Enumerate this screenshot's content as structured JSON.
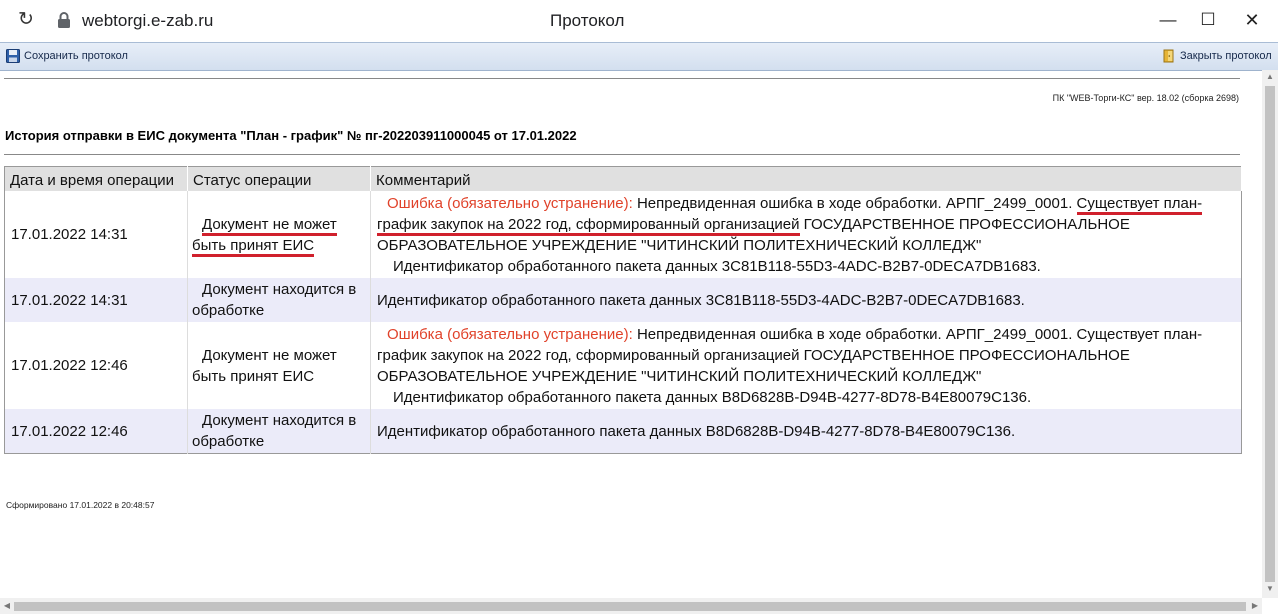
{
  "browser": {
    "url": "webtorgi.e-zab.ru",
    "window_title": "Протокол",
    "reload_glyph": "↻",
    "minimize_glyph": "—",
    "maximize_glyph": "☐",
    "close_glyph": "✕"
  },
  "toolbar": {
    "save_label": "Сохранить протокол",
    "close_label": "Закрыть протокол"
  },
  "report": {
    "version": "ПК \"WEB-Торги-КС\" вер. 18.02 (сборка 2698)",
    "heading": "История отправки в ЕИС документа \"План - график\" № пг-202203911000045 от 17.01.2022",
    "columns": [
      "Дата и время операции",
      "Статус операции",
      "Комментарий"
    ],
    "rows": [
      {
        "datetime": "17.01.2022 14:31",
        "status_line1": "Документ не может",
        "status_line2": "быть принят ЕИС",
        "error_prefix": "Ошибка (обязательно устранение):",
        "comment_a": " Непредвиденная ошибка в ходе обработки. АРПГ_2499_0001. ",
        "comment_b": "Существует план-",
        "comment_c": "график закупок на 2022 год, сформированный организацией",
        "comment_d": " ГОСУДАРСТВЕННОЕ ПРОФЕССИОНАЛЬНОЕ",
        "comment_e": "ОБРАЗОВАТЕЛЬНОЕ УЧРЕЖДЕНИЕ \"ЧИТИНСКИЙ ПОЛИТЕХНИЧЕСКИЙ КОЛЛЕДЖ\"",
        "package": "Идентификатор обработанного пакета данных 3C81B118-55D3-4ADC-B2B7-0DECA7DB1683."
      },
      {
        "datetime": "17.01.2022 14:31",
        "status_line1": "Документ находится в",
        "status_line2": "обработке",
        "package": "Идентификатор обработанного пакета данных 3C81B118-55D3-4ADC-B2B7-0DECA7DB1683."
      },
      {
        "datetime": "17.01.2022 12:46",
        "status_line1": "Документ не может",
        "status_line2": "быть принят ЕИС",
        "error_prefix": "Ошибка (обязательно устранение):",
        "comment_a": " Непредвиденная ошибка в ходе обработки. АРПГ_2499_0001. Существует план-",
        "comment_c": "график закупок на 2022 год, сформированный организацией ГОСУДАРСТВЕННОЕ ПРОФЕССИОНАЛЬНОЕ",
        "comment_e": "ОБРАЗОВАТЕЛЬНОЕ УЧРЕЖДЕНИЕ \"ЧИТИНСКИЙ ПОЛИТЕХНИЧЕСКИЙ КОЛЛЕДЖ\"",
        "package": "Идентификатор обработанного пакета данных B8D6828B-D94B-4277-8D78-B4E80079C136."
      },
      {
        "datetime": "17.01.2022 12:46",
        "status_line1": "Документ находится в",
        "status_line2": "обработке",
        "package": "Идентификатор обработанного пакета данных B8D6828B-D94B-4277-8D78-B4E80079C136."
      }
    ],
    "footer": "Сформировано 17.01.2022 в 20:48:57"
  },
  "colors": {
    "error": "#e0422a",
    "underline": "#d0202c",
    "header_bg": "#e0e0e0",
    "alt_row_bg": "#ebebf9"
  }
}
